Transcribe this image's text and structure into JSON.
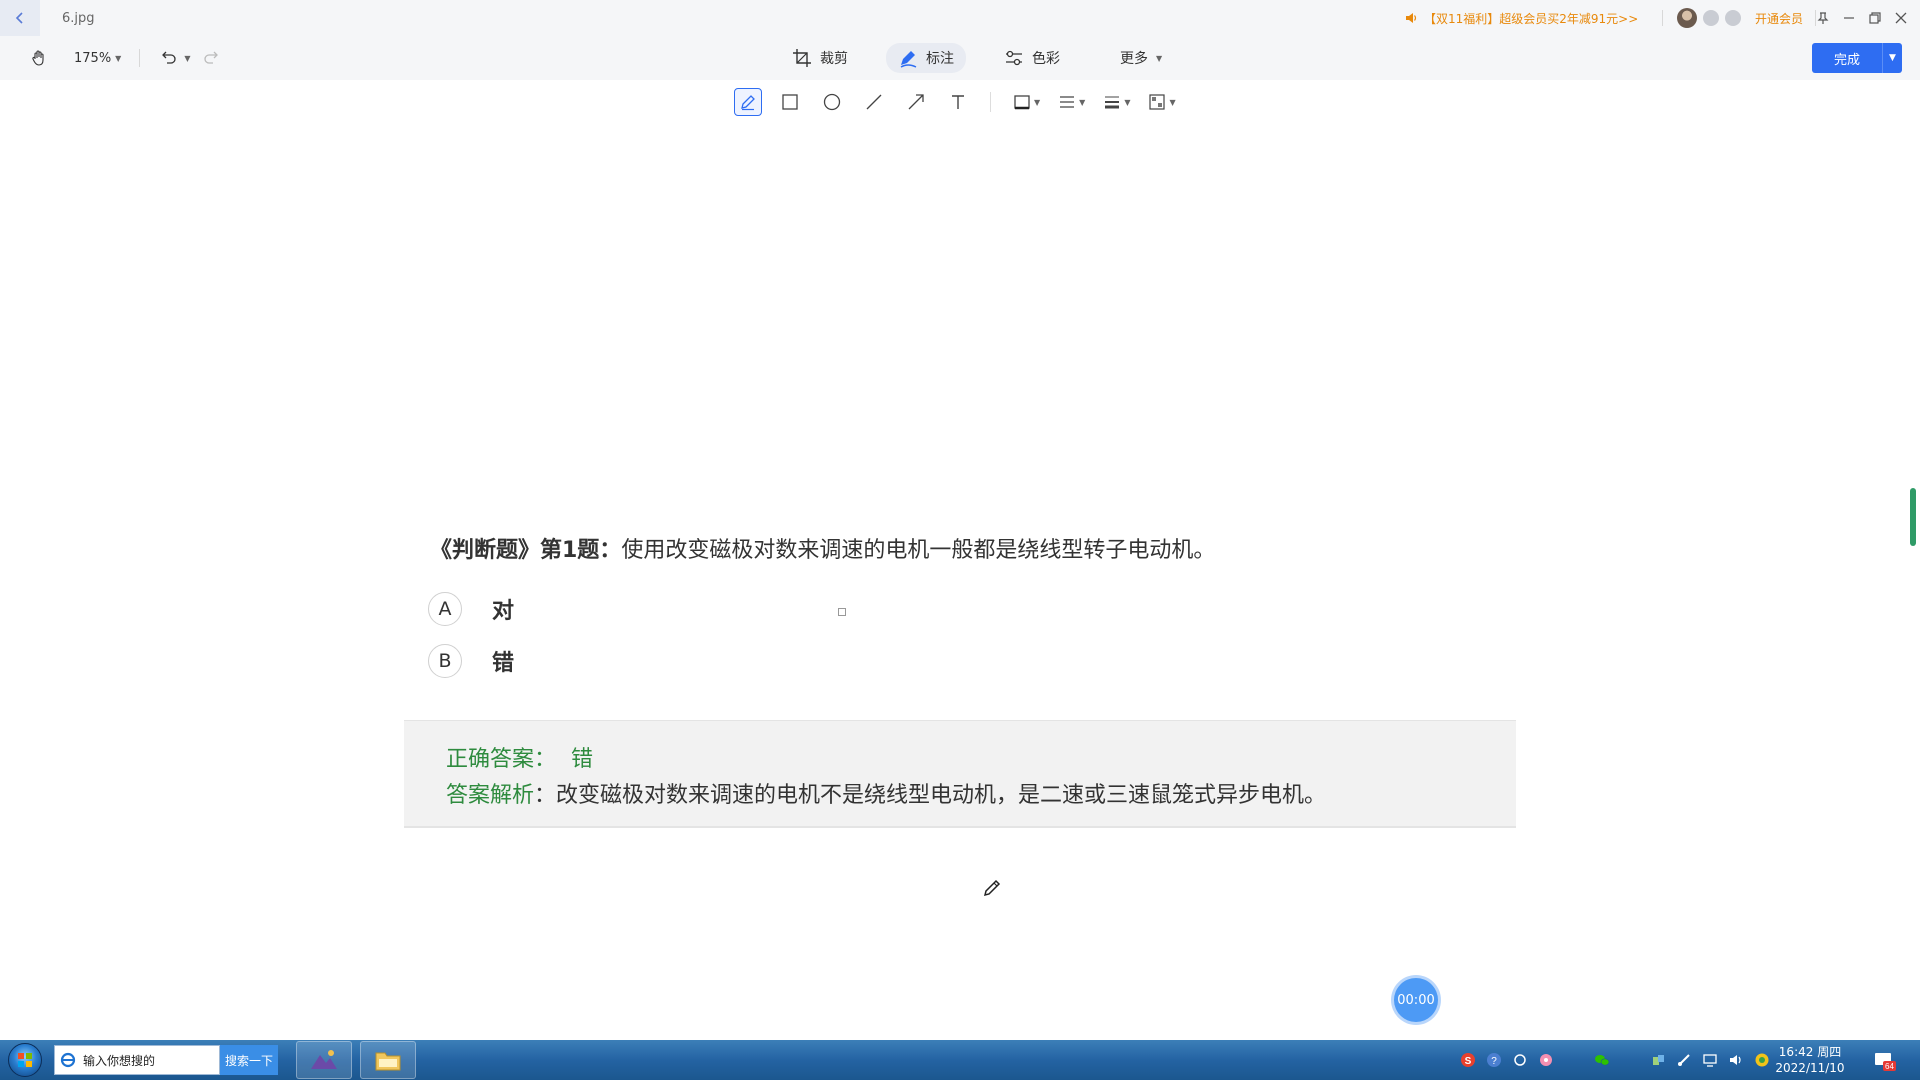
{
  "title_bar": {
    "filename": "6.jpg",
    "promo": "【双11福利】超级会员买2年减91元>>",
    "vip_link": "开通会员"
  },
  "toolbar": {
    "zoom": "175%",
    "crop_label": "裁剪",
    "annotate_label": "标注",
    "color_label": "色彩",
    "more_label": "更多",
    "done_label": "完成"
  },
  "document": {
    "question_tag": "《判断题》第1题：",
    "question_text": "使用改变磁极对数来调速的电机一般都是绕线型转子电动机。",
    "options": [
      {
        "letter": "A",
        "text": "对"
      },
      {
        "letter": "B",
        "text": "错"
      }
    ],
    "answer_label": "正确答案：",
    "answer_value": "错",
    "analysis_label": "答案解析",
    "analysis_text": "：改变磁极对数来调速的电机不是绕线型电动机，是二速或三速鼠笼式异步电机。"
  },
  "timer": "00:00",
  "taskbar": {
    "search_placeholder": "输入你想搜的",
    "search_button": "搜索一下",
    "time": "16:42 周四",
    "date": "2022/11/10",
    "notif_count": "64"
  },
  "colors": {
    "accent": "#2e6df2",
    "answer_green": "#2e8b3e",
    "promo_orange": "#e8890c"
  }
}
